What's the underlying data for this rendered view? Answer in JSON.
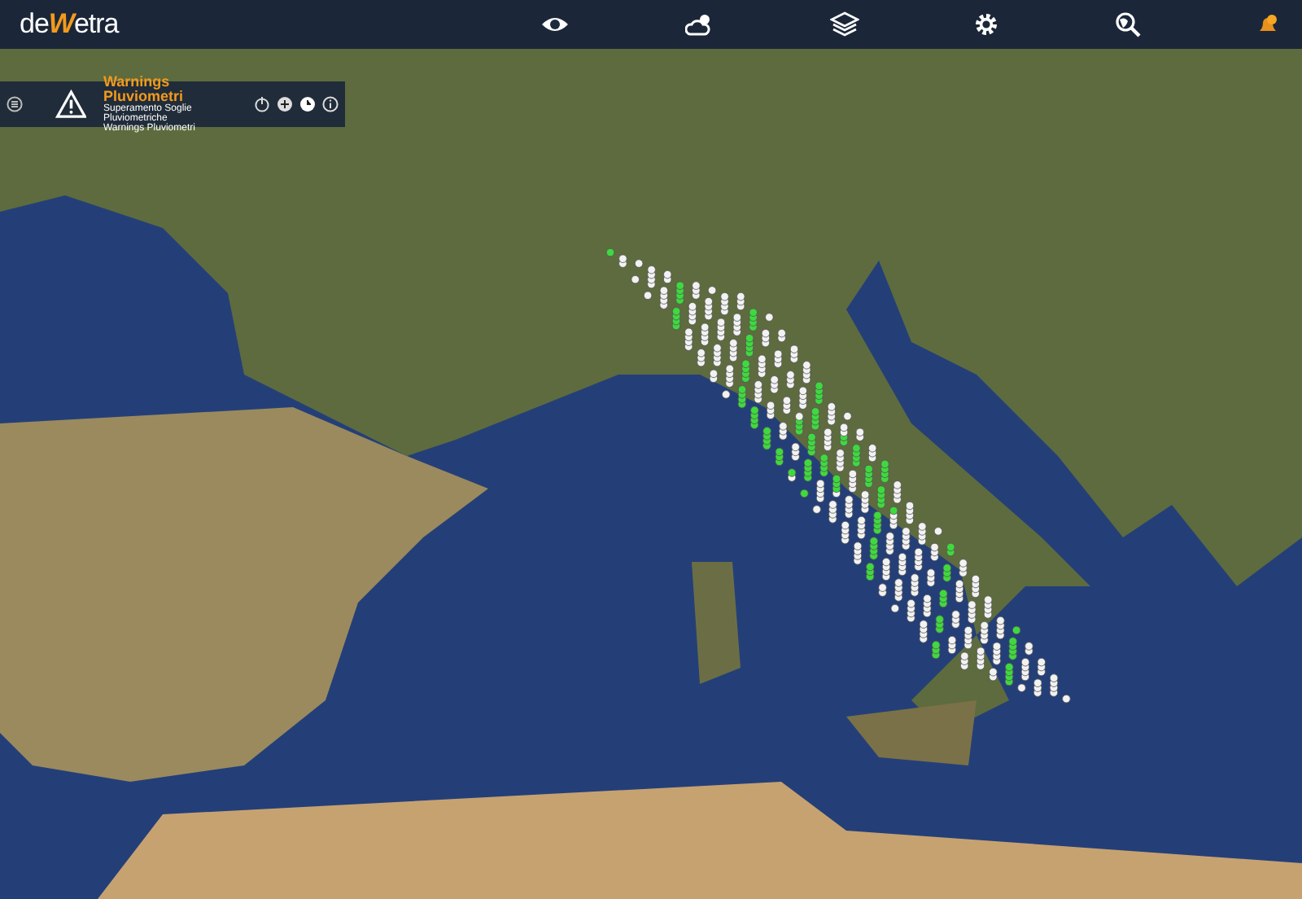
{
  "logo": {
    "prefix": "de",
    "mark": "W",
    "suffix": "etra"
  },
  "toolbar": [
    {
      "kind": "eye"
    },
    {
      "kind": "weather"
    },
    {
      "kind": "layers"
    },
    {
      "kind": "settings"
    },
    {
      "kind": "globe-search"
    },
    {
      "kind": "bell"
    }
  ],
  "layer_panel": {
    "title": "Warnings Pluviometri",
    "subtitle": "Superamento Soglie Pluviometriche",
    "source": "Warnings Pluviometri"
  }
}
